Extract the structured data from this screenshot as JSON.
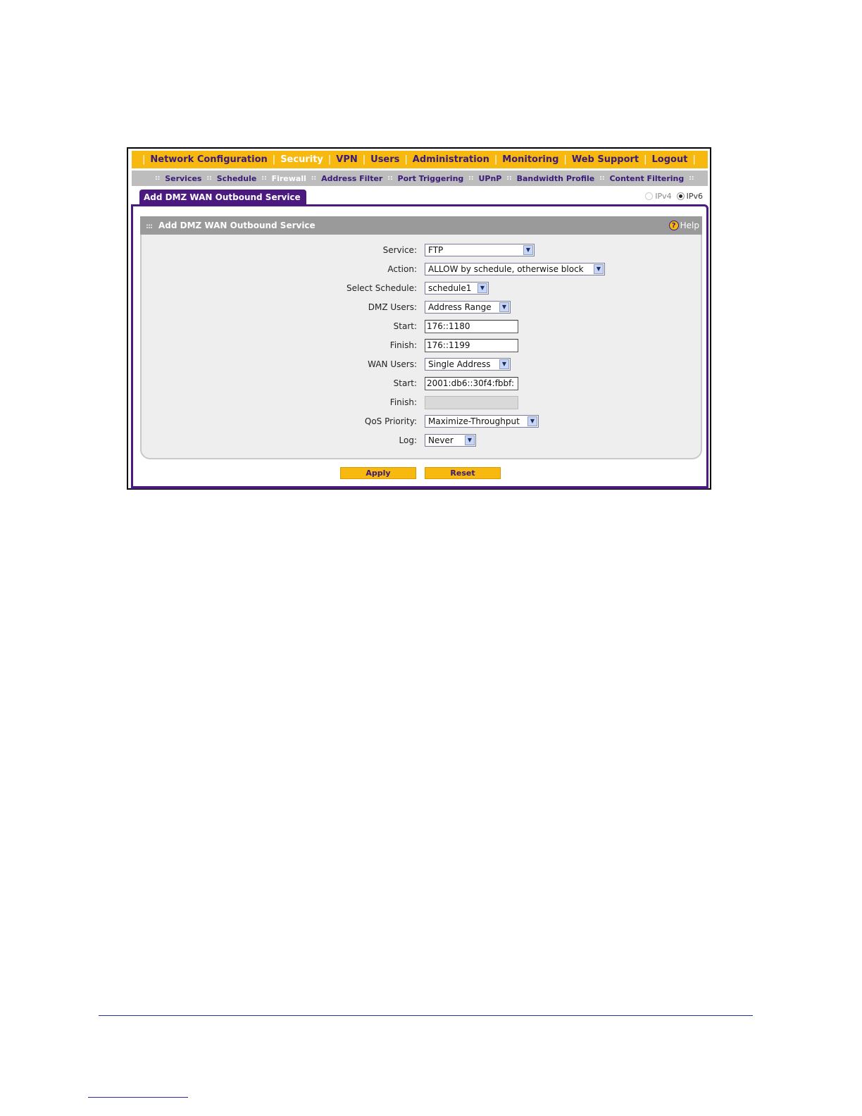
{
  "top_nav": {
    "items": [
      "Network Configuration",
      "Security",
      "VPN",
      "Users",
      "Administration",
      "Monitoring",
      "Web Support",
      "Logout"
    ],
    "active": "Security"
  },
  "sub_nav": {
    "items": [
      "Services",
      "Schedule",
      "Firewall",
      "Address Filter",
      "Port Triggering",
      "UPnP",
      "Bandwidth Profile",
      "Content Filtering"
    ],
    "active": "Firewall"
  },
  "tab": {
    "label": "Add DMZ WAN Outbound Service"
  },
  "ip_version": {
    "ipv4_label": "IPv4",
    "ipv6_label": "IPv6",
    "selected": "IPv6"
  },
  "panel": {
    "title": "Add DMZ WAN Outbound Service",
    "help_label": "Help"
  },
  "form": {
    "service": {
      "label": "Service:",
      "value": "FTP"
    },
    "action": {
      "label": "Action:",
      "value": "ALLOW by schedule, otherwise block"
    },
    "schedule": {
      "label": "Select Schedule:",
      "value": "schedule1"
    },
    "dmz_users": {
      "label": "DMZ Users:",
      "value": "Address Range"
    },
    "dmz_start": {
      "label": "Start:",
      "value": "176::1180"
    },
    "dmz_finish": {
      "label": "Finish:",
      "value": "176::1199"
    },
    "wan_users": {
      "label": "WAN Users:",
      "value": "Single Address"
    },
    "wan_start": {
      "label": "Start:",
      "value": "2001:db6::30f4:fbbf:"
    },
    "wan_finish": {
      "label": "Finish:",
      "value": ""
    },
    "qos": {
      "label": "QoS Priority:",
      "value": "Maximize-Throughput"
    },
    "log": {
      "label": "Log:",
      "value": "Never"
    }
  },
  "buttons": {
    "apply": "Apply",
    "reset": "Reset"
  },
  "colors": {
    "nav_bg": "#f7b80f",
    "nav_text": "#3a1a7a",
    "tab_bg": "#4b1a7e",
    "subnav_bg": "#bdbdbd",
    "panel_head_bg": "#9a9a9a"
  }
}
